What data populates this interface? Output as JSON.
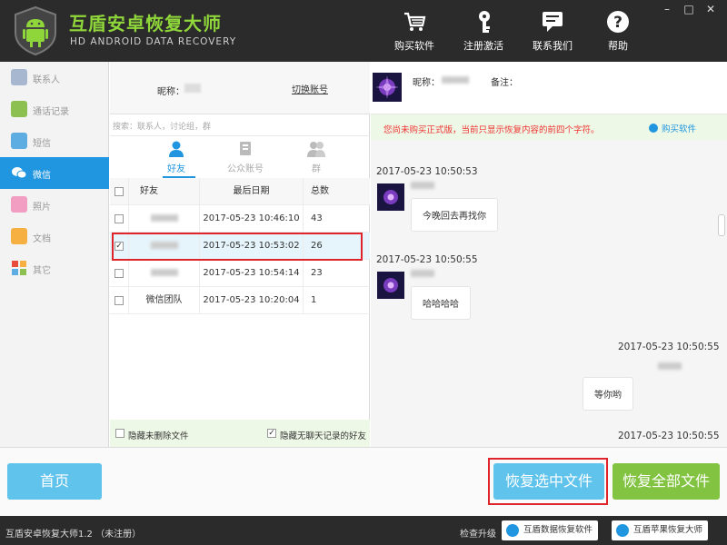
{
  "header": {
    "title": "互盾安卓恢复大师",
    "subtitle": "HD ANDROID DATA RECOVERY",
    "tools": [
      {
        "label": "购买软件",
        "icon": "cart-icon"
      },
      {
        "label": "注册激活",
        "icon": "key-icon"
      },
      {
        "label": "联系我们",
        "icon": "chat-icon"
      },
      {
        "label": "帮助",
        "icon": "help-icon"
      }
    ],
    "window_controls": [
      "–",
      "□",
      "✕"
    ]
  },
  "sidebar": {
    "items": [
      {
        "label": "联系人",
        "icon": "contacts-icon",
        "color": "#a6b7cf"
      },
      {
        "label": "通话记录",
        "icon": "phone-icon",
        "color": "#8cc152"
      },
      {
        "label": "短信",
        "icon": "sms-icon",
        "color": "#5dade2"
      },
      {
        "label": "微信",
        "icon": "wechat-icon",
        "color": "#ffffff",
        "active": true
      },
      {
        "label": "照片",
        "icon": "photo-icon",
        "color": "#f19ec2"
      },
      {
        "label": "文档",
        "icon": "document-icon",
        "color": "#f5b041"
      },
      {
        "label": "其它",
        "icon": "other-icon",
        "color": "#e74c3c"
      }
    ]
  },
  "account": {
    "nick_label": "昵称：",
    "switch_label": "切换账号"
  },
  "search": {
    "placeholder": "搜索：联系人，讨论组，群"
  },
  "tabs": [
    {
      "label": "好友",
      "active": true
    },
    {
      "label": "公众账号",
      "active": false
    },
    {
      "label": "群",
      "active": false
    }
  ],
  "table": {
    "headers": [
      "好友",
      "最后日期",
      "总数"
    ],
    "rows": [
      {
        "name": "",
        "date": "2017-05-23 10:46:10",
        "count": "43",
        "checked": false
      },
      {
        "name": "",
        "date": "2017-05-23 10:53:02",
        "count": "26",
        "checked": true
      },
      {
        "name": "",
        "date": "2017-05-23 10:54:14",
        "count": "23",
        "checked": false
      },
      {
        "name": "微信团队",
        "date": "2017-05-23 10:20:04",
        "count": "1",
        "checked": false
      }
    ]
  },
  "middle_footer": {
    "hide_deleted": "隐藏未删除文件",
    "hide_no_chat": "隐藏无聊天记录的好友",
    "hide_no_chat_checked": true
  },
  "chat": {
    "nick_label": "昵称：",
    "note_label": "备注：",
    "notice": "您尚未购买正式版，当前只显示恢复内容的前四个字符。",
    "buy_link": "购买软件",
    "messages": [
      {
        "time": "2017-05-23 10:50:53",
        "text": "今晚回去再找你",
        "side": "left"
      },
      {
        "time": "2017-05-23 10:50:55",
        "text": "哈哈哈哈",
        "side": "left"
      },
      {
        "time": "2017-05-23 10:50:55",
        "text": "等你哟",
        "side": "right"
      },
      {
        "time": "2017-05-23 10:50:55",
        "text": "",
        "side": "right"
      }
    ]
  },
  "bottom": {
    "home": "首页",
    "recover_selected": "恢复选中文件",
    "recover_all": "恢复全部文件"
  },
  "status": {
    "app": "互盾安卓恢复大师1.2 （未注册）",
    "update": "检查升级",
    "btn1": "互盾数据恢复软件",
    "btn2": "互盾苹果恢复大师"
  },
  "colors": {
    "accent": "#2196e0",
    "brand_green": "#8fd63a",
    "highlight": "#e0242b",
    "recover_all": "#82c341"
  }
}
